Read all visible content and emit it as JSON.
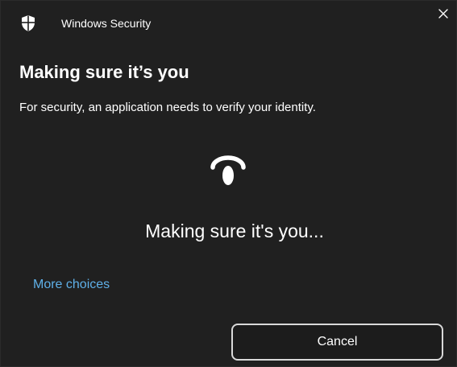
{
  "window": {
    "app_title": "Windows Security",
    "app_icon": "shield-icon",
    "close_icon": "close-icon"
  },
  "dialog": {
    "heading": "Making sure it’s you",
    "subtext": "For security, an application needs to verify your identity.",
    "status_icon": "face-scan-spinner-icon",
    "status_text": "Making sure it's you...",
    "more_choices_label": "More choices",
    "cancel_label": "Cancel"
  },
  "colors": {
    "background": "#202020",
    "text": "#ffffff",
    "link": "#5fb0e8",
    "button_border": "#d9d9d9"
  }
}
